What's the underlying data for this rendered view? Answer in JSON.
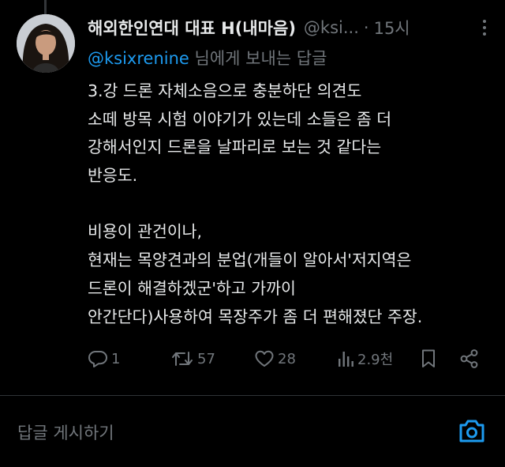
{
  "tweet": {
    "author_name": "해외한인연대 대표 H(내마음)",
    "handle": "@ksi...",
    "separator": "·",
    "time": "15시",
    "reply_to_handle": "@ksixrenine",
    "reply_to_suffix": " 님에게 보내는 답글",
    "lines": [
      "3.강 드론 자체소음으로 충분하단 의견도",
      "소떼 방목 시험 이야기가 있는데 소들은 좀 더",
      "강해서인지 드론을 날파리로 보는 것 같다는",
      "반응도.",
      "",
      "비용이 관건이나,",
      "현재는 목양견과의 분업(개들이 알아서'저지역은",
      "드론이 해결하겠군'하고 가까이",
      "안간단다)사용하여 목장주가 좀 더 편해졌단 주장."
    ]
  },
  "actions": {
    "reply_count": "1",
    "retweet_count": "57",
    "like_count": "28",
    "views_count": "2.9천"
  },
  "compose": {
    "placeholder": "답글 게시하기"
  },
  "colors": {
    "background": "#000000",
    "text": "#e7e9ea",
    "muted": "#71767b",
    "accent": "#1d9bf0",
    "divider": "#2f3336"
  },
  "icons": {
    "more": "more-vertical-icon",
    "reply": "reply-icon",
    "retweet": "retweet-icon",
    "like": "heart-icon",
    "views": "views-icon",
    "bookmark": "bookmark-icon",
    "share": "share-icon",
    "camera": "camera-icon"
  }
}
